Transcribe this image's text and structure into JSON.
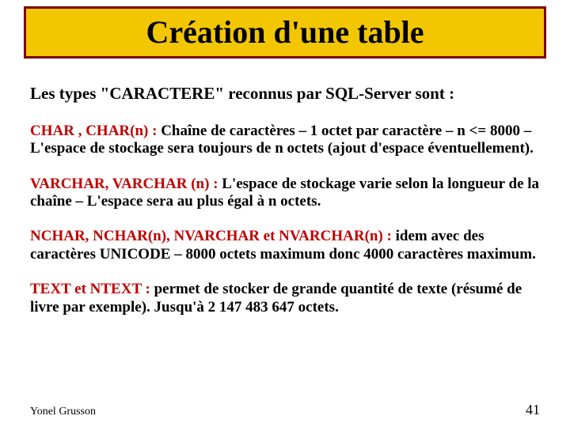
{
  "title": "Création d'une table",
  "intro": "Les types \"CARACTERE\" reconnus par SQL-Server sont :",
  "paragraphs": [
    {
      "term": "CHAR , CHAR(n) :",
      "text": " Chaîne de caractères – 1 octet par caractère – n <= 8000 – L'espace de stockage sera toujours de n octets (ajout d'espace éventuellement)."
    },
    {
      "term": "VARCHAR, VARCHAR (n) :",
      "text": " L'espace de stockage varie selon la longueur de la chaîne – L'espace sera au plus égal à n octets."
    },
    {
      "term": "NCHAR, NCHAR(n), NVARCHAR et NVARCHAR(n) :",
      "text": " idem avec des caractères UNICODE – 8000 octets maximum donc 4000 caractères maximum."
    },
    {
      "term": "TEXT et NTEXT :",
      "text": " permet de stocker de grande quantité de texte (résumé de livre par exemple). Jusqu'à 2 147 483 647 octets."
    }
  ],
  "footer": {
    "author": "Yonel Grusson",
    "page": "41"
  }
}
